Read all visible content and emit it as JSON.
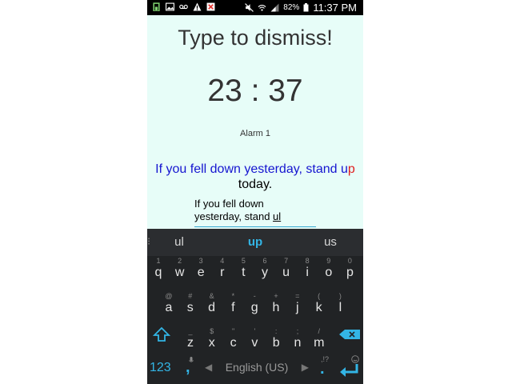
{
  "status_bar": {
    "battery": "82%",
    "time": "11:37 PM",
    "icons_left": [
      "battery-saver-icon",
      "image-icon",
      "voicemail-icon",
      "warning-icon",
      "missed-call-icon"
    ],
    "icons_right": [
      "mute-icon",
      "wifi-icon",
      "signal-icon",
      "battery-icon"
    ]
  },
  "screen": {
    "title": "Type to dismiss!",
    "clock": "23 : 37",
    "alarm_label": "Alarm 1",
    "phrase_typed": "If you fell down yesterday, stand u",
    "phrase_error": "p",
    "phrase_rest": "today.",
    "input_line1": "If you fell down",
    "input_line2_prefix": "yesterday, stand ",
    "input_line2_current": "ul"
  },
  "keyboard": {
    "suggestions": [
      "ul",
      "up",
      "us"
    ],
    "row1": [
      {
        "k": "q",
        "h": "1"
      },
      {
        "k": "w",
        "h": "2"
      },
      {
        "k": "e",
        "h": "3"
      },
      {
        "k": "r",
        "h": "4"
      },
      {
        "k": "t",
        "h": "5"
      },
      {
        "k": "y",
        "h": "6"
      },
      {
        "k": "u",
        "h": "7"
      },
      {
        "k": "i",
        "h": "8"
      },
      {
        "k": "o",
        "h": "9"
      },
      {
        "k": "p",
        "h": "0"
      }
    ],
    "row2": [
      {
        "k": "a",
        "h": "@"
      },
      {
        "k": "s",
        "h": "#"
      },
      {
        "k": "d",
        "h": "&"
      },
      {
        "k": "f",
        "h": "*"
      },
      {
        "k": "g",
        "h": "-"
      },
      {
        "k": "h",
        "h": "+"
      },
      {
        "k": "j",
        "h": "="
      },
      {
        "k": "k",
        "h": "("
      },
      {
        "k": "l",
        "h": ")"
      }
    ],
    "row3": [
      {
        "k": "z",
        "h": "_"
      },
      {
        "k": "x",
        "h": "$"
      },
      {
        "k": "c",
        "h": "\""
      },
      {
        "k": "v",
        "h": "'"
      },
      {
        "k": "b",
        "h": ":"
      },
      {
        "k": "n",
        "h": ";"
      },
      {
        "k": "m",
        "h": "/"
      }
    ],
    "symbols_key": "123",
    "comma_key": ",",
    "period_key": ".",
    "period_hint": ",!?",
    "space_label": "English (US)",
    "accent": "#33b5e5"
  }
}
